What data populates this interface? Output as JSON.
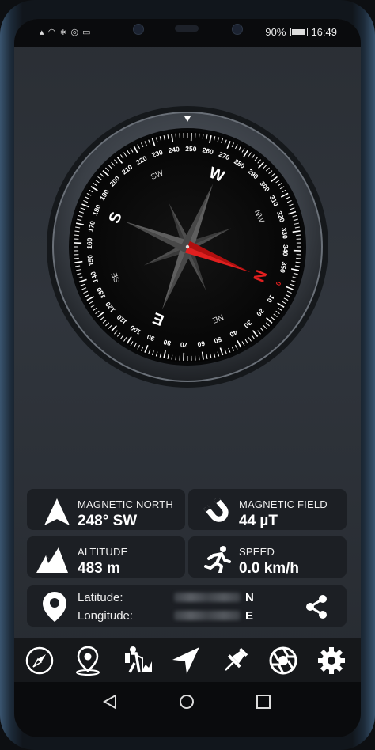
{
  "status_bar": {
    "left_icons": "▴ ◠ ∗ ◎ ▭",
    "battery": "90%",
    "time": "16:49"
  },
  "compass": {
    "cardinals": [
      "N",
      "E",
      "S",
      "W"
    ],
    "intercardinals": [
      "NE",
      "SE",
      "SW",
      "NW"
    ],
    "degree_labels": [
      "0",
      "10",
      "20",
      "30",
      "40",
      "50",
      "60",
      "70",
      "80",
      "90",
      "100",
      "110",
      "120",
      "130",
      "140",
      "150",
      "160",
      "170",
      "180",
      "190",
      "200",
      "210",
      "220",
      "230",
      "240",
      "250",
      "260",
      "270",
      "280",
      "290",
      "300",
      "310",
      "320",
      "330",
      "340",
      "350"
    ],
    "heading_degrees": 248,
    "accent_color": "#e01f1f"
  },
  "cards": {
    "magnetic_north": {
      "label": "MAGNETIC NORTH",
      "value": "248° SW",
      "icon": "north-arrow-icon"
    },
    "magnetic_field": {
      "label": "MAGNETIC FIELD",
      "value": "44 µT",
      "icon": "magnet-icon"
    },
    "altitude": {
      "label": "ALTITUDE",
      "value": "483 m",
      "icon": "mountain-icon"
    },
    "speed": {
      "label": "SPEED",
      "value": "0.0 km/h",
      "icon": "running-person-icon"
    }
  },
  "location": {
    "latitude_label": "Latitude:",
    "latitude_dir": "N",
    "longitude_label": "Longitude:",
    "longitude_dir": "E"
  },
  "toolbar": [
    "compass-icon",
    "map-pin-icon",
    "hiker-icon",
    "navigation-arrow-icon",
    "push-pin-icon",
    "camera-aperture-icon",
    "gear-icon"
  ]
}
